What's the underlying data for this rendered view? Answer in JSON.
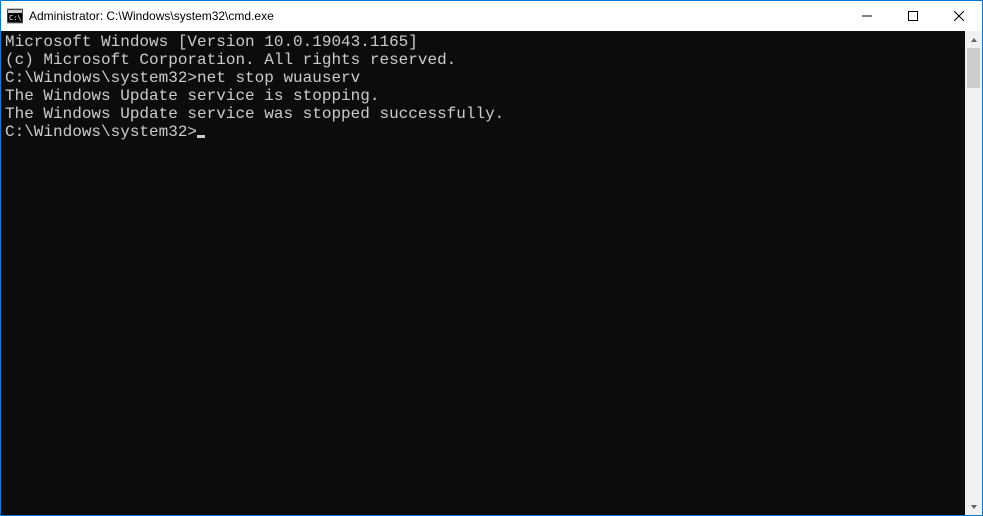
{
  "titlebar": {
    "title": "Administrator: C:\\Windows\\system32\\cmd.exe"
  },
  "console": {
    "line1": "Microsoft Windows [Version 10.0.19043.1165]",
    "line2": "(c) Microsoft Corporation. All rights reserved.",
    "blank1": "",
    "prompt1": "C:\\Windows\\system32>",
    "command1": "net stop wuauserv",
    "output1": "The Windows Update service is stopping.",
    "output2": "The Windows Update service was stopped successfully.",
    "blank2": "",
    "blank3": "",
    "prompt2": "C:\\Windows\\system32>"
  }
}
